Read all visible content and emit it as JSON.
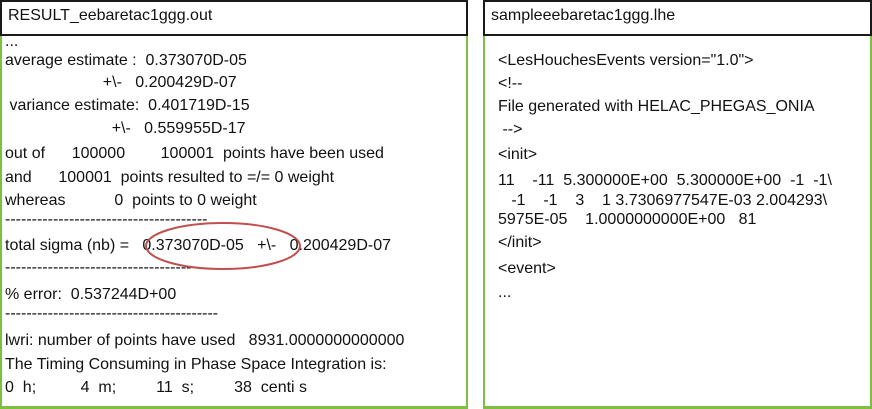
{
  "left_panel": {
    "title": "RESULT_eebaretac1ggg.out",
    "lines": [
      "...",
      "average estimate :  0.373070D-05",
      "                      +\\-   0.200429D-07",
      " variance estimate:  0.401719D-15",
      "                        +\\-   0.559955D-17",
      "out of      100000        100001  points have been used",
      "and      100001  points resulted to =/= 0 weight",
      "whereas           0  points to 0 weight",
      "--------------------------------------",
      "total sigma (nb) =   0.373070D-05   +\\-   0.200429D-07",
      "-----------------------------------",
      "% error:  0.537244D+00",
      "----------------------------------------",
      "lwri: number of points have used   8931.0000000000000",
      "The Timing Consuming in Phase Space Integration is:",
      "0  h;          4  m;         11  s;         38  centi s"
    ],
    "highlight_color": "#c0504d"
  },
  "right_panel": {
    "title": "sampleeebaretac1ggg.lhe",
    "lines": [
      "<LesHouchesEvents version=\"1.0\">",
      "<!--",
      "File generated with HELAC_PHEGAS_ONIA",
      " -->",
      "<init>",
      "11    -11  5.300000E+00  5.300000E+00  -1  -1\\",
      "   -1    -1    3    1 3.7306977547E-03 2.004293\\",
      "5975E-05    1.0000000000E+00   81",
      "</init>",
      "<event>",
      "..."
    ]
  },
  "colors": {
    "border_green": "#7bc043",
    "header_border": "#1a1a1a",
    "text": "#111111"
  }
}
